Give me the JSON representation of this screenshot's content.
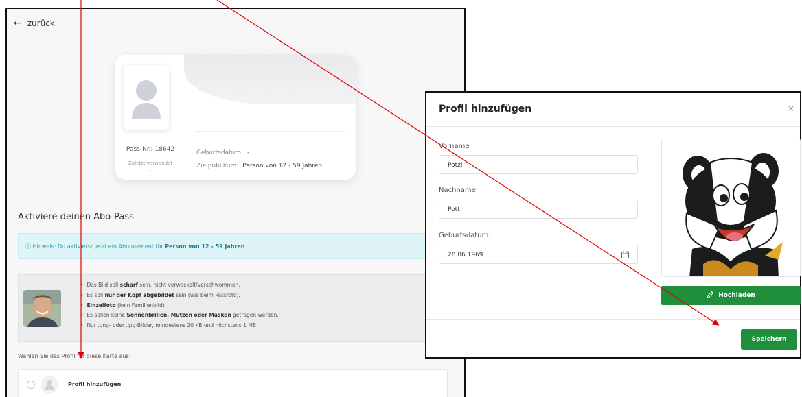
{
  "page": {
    "back_label": "zurück",
    "card": {
      "pass_nr": "Pass-Nr.: 18642",
      "last_used_label": "Zuletzt verwendet",
      "last_used_value": "-",
      "birthdate_label": "Geburtsdatum:",
      "birthdate_value": "-",
      "audience_label": "Zielpublikum:",
      "audience_value": "Person von 12 - 59 Jahren"
    },
    "section_title": "Aktiviere deinen Abo-Pass",
    "hint": {
      "icon": "info-circle-icon",
      "prefix": "Hinweis: Du aktivierst jetzt ein Abonnement für ",
      "bold": "Person von 12 - 59 Jahren"
    },
    "guidelines": [
      {
        "pre": "Das Bild soll ",
        "bold": "scharf",
        "post": " sein, nicht verwackelt/verschwommen."
      },
      {
        "pre": "Es soll ",
        "bold": "nur der Kopf abgebildet",
        "post": " sein (wie beim Passfoto)."
      },
      {
        "pre": "",
        "bold": "Einzelfoto",
        "post": " (kein Familienbild)."
      },
      {
        "pre": "Es sollen keine ",
        "bold": "Sonnenbrillen, Mützen oder Masken",
        "post": " getragen werden."
      },
      {
        "pre": "Nur .png- oder .jpg-Bilder, mindestens 20 KB und höchstens 1 MB",
        "bold": "",
        "post": ""
      }
    ],
    "select_label": "Wählen Sie das Profil für diese Karte aus:",
    "add_profile_label": "Profil hinzufügen"
  },
  "modal": {
    "title": "Profil hinzufügen",
    "close_icon": "close-icon",
    "firstname_label": "Vorname",
    "firstname_value": "Potzi",
    "lastname_label": "Nachname",
    "lastname_value": "Pott",
    "birthdate_label": "Geburtsdatum:",
    "birthdate_value": "28.06.1969",
    "upload_label": "Hochladen",
    "save_label": "Speichern"
  },
  "colors": {
    "primary_green": "#1f8f3b",
    "hint_bg": "#dff4f6",
    "hint_text": "#2aa3b3",
    "annotation_red": "#e00000"
  }
}
